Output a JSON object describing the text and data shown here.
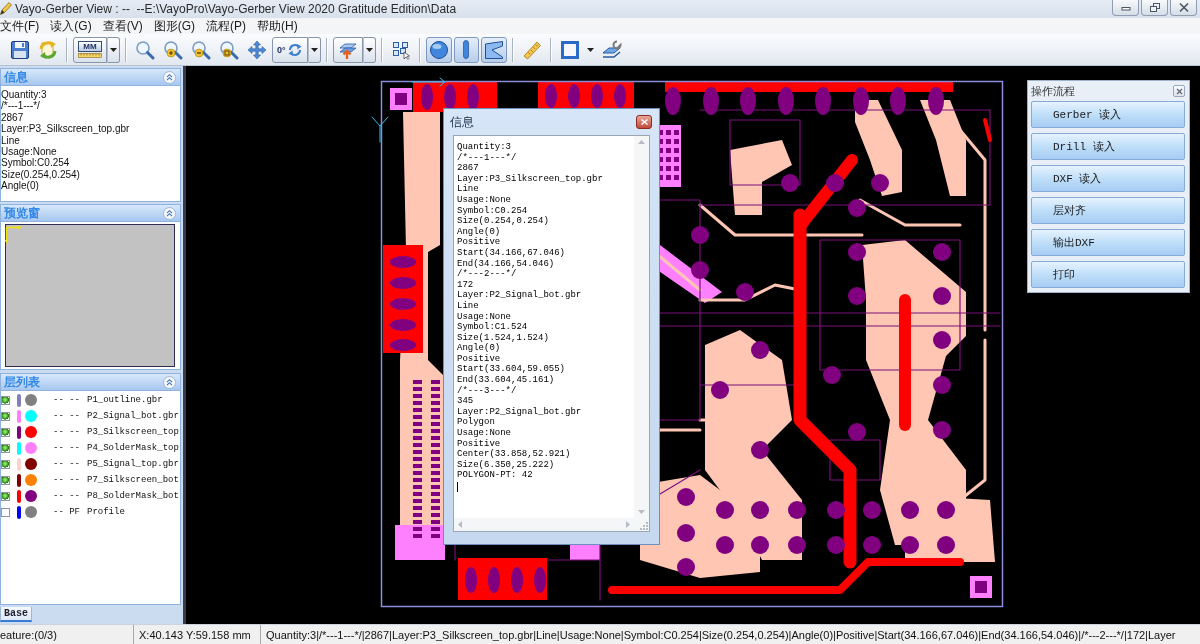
{
  "window": {
    "title": "Vayo-Gerber View : --  --E:\\VayoPro\\Vayo-Gerber View 2020 Gratitude Edition\\Data"
  },
  "menu": [
    "文件(F)",
    "读入(G)",
    "查看(V)",
    "图形(G)",
    "流程(P)",
    "帮助(H)"
  ],
  "toolbar": {
    "unit_label": "MM",
    "rotation_label": "0°",
    "shape_filters": [
      {
        "on": true
      },
      {
        "on": true
      },
      {
        "on": true
      }
    ]
  },
  "info_panel": {
    "title": "信息",
    "lines": [
      "Quantity:3",
      "/*---1---*/",
      "2867",
      "Layer:P3_Silkscreen_top.gbr",
      "Line",
      "Usage:None",
      "Symbol:C0.254",
      "Size(0.254,0.254)",
      "Angle(0)"
    ]
  },
  "preview_panel": {
    "title": "预览窗"
  },
  "layer_panel": {
    "title": "层列表",
    "layers": [
      {
        "checked": true,
        "bar": {
          "color": "#8080c0"
        },
        "color": "#808080",
        "status": "-- --",
        "name": "P1_outline.gbr"
      },
      {
        "checked": true,
        "bar": {
          "color": "#ff80ff"
        },
        "color": "#00ffff",
        "status": "-- --",
        "name": "P2_Signal_bot.gbr"
      },
      {
        "checked": true,
        "bar": {
          "color": "#800080"
        },
        "color": "#ff0000",
        "status": "-- --",
        "name": "P3_Silkscreen_top"
      },
      {
        "checked": true,
        "bar": {
          "color": "#00ffff"
        },
        "color": "#ff80ff",
        "status": "-- --",
        "name": "P4_SolderMask_top"
      },
      {
        "checked": true,
        "bar": {
          "color": "#ffd0d0"
        },
        "color": "#800000",
        "status": "-- --",
        "name": "P5_Signal_top.gbr"
      },
      {
        "checked": true,
        "bar": {
          "color": "#800000"
        },
        "color": "#ff8000",
        "status": "-- --",
        "name": "P7_Silkscreen_bot"
      },
      {
        "checked": true,
        "bar": {
          "color": "#ff0000"
        },
        "color": "#800080",
        "status": "-- --",
        "name": "P8_SolderMask_bot"
      },
      {
        "checked": false,
        "bar": {
          "color": "#0000ff"
        },
        "color": "#808080",
        "status": "-- PF",
        "name": "Profile"
      }
    ]
  },
  "tabs": [
    {
      "label": "Base",
      "selected": true
    }
  ],
  "info_dialog": {
    "title": "信息",
    "lines": [
      "Quantity:3",
      "/*---1---*/",
      "2867",
      "Layer:P3_Silkscreen_top.gbr",
      "Line",
      "Usage:None",
      "Symbol:C0.254",
      "Size(0.254,0.254)",
      "Angle(0)",
      "Positive",
      "Start(34.166,67.046)",
      "End(34.166,54.046)",
      "/*---2---*/",
      "172",
      "Layer:P2_Signal_bot.gbr",
      "Line",
      "Usage:None",
      "Symbol:C1.524",
      "Size(1.524,1.524)",
      "Angle(0)",
      "Positive",
      "Start(33.604,59.055)",
      "End(33.604,45.161)",
      "/*---3---*/",
      "345",
      "Layer:P2_Signal_bot.gbr",
      "Polygon",
      "Usage:None",
      "Positive",
      "Center(33.858,52.921)",
      "Size(6.350,25.222)",
      "POLYGON-PT: 42"
    ]
  },
  "flow_panel": {
    "title": "操作流程",
    "buttons": [
      "Gerber 读入",
      "Drill 读入",
      "DXF 读入",
      "层对齐",
      "输出DXF",
      "打印"
    ]
  },
  "status_bar": {
    "feature": "eature:(0/3)",
    "coordinates": "X:40.143 Y:59.158 mm",
    "selection": "Quantity:3|/*---1---*/|2867|Layer:P3_Silkscreen_top.gbr|Line|Usage:None|Symbol:C0.254|Size(0.254,0.254)|Angle(0)|Positive|Start(34.166,67.046)|End(34.166,54.046)|/*---2---*/|172|Layer"
  }
}
